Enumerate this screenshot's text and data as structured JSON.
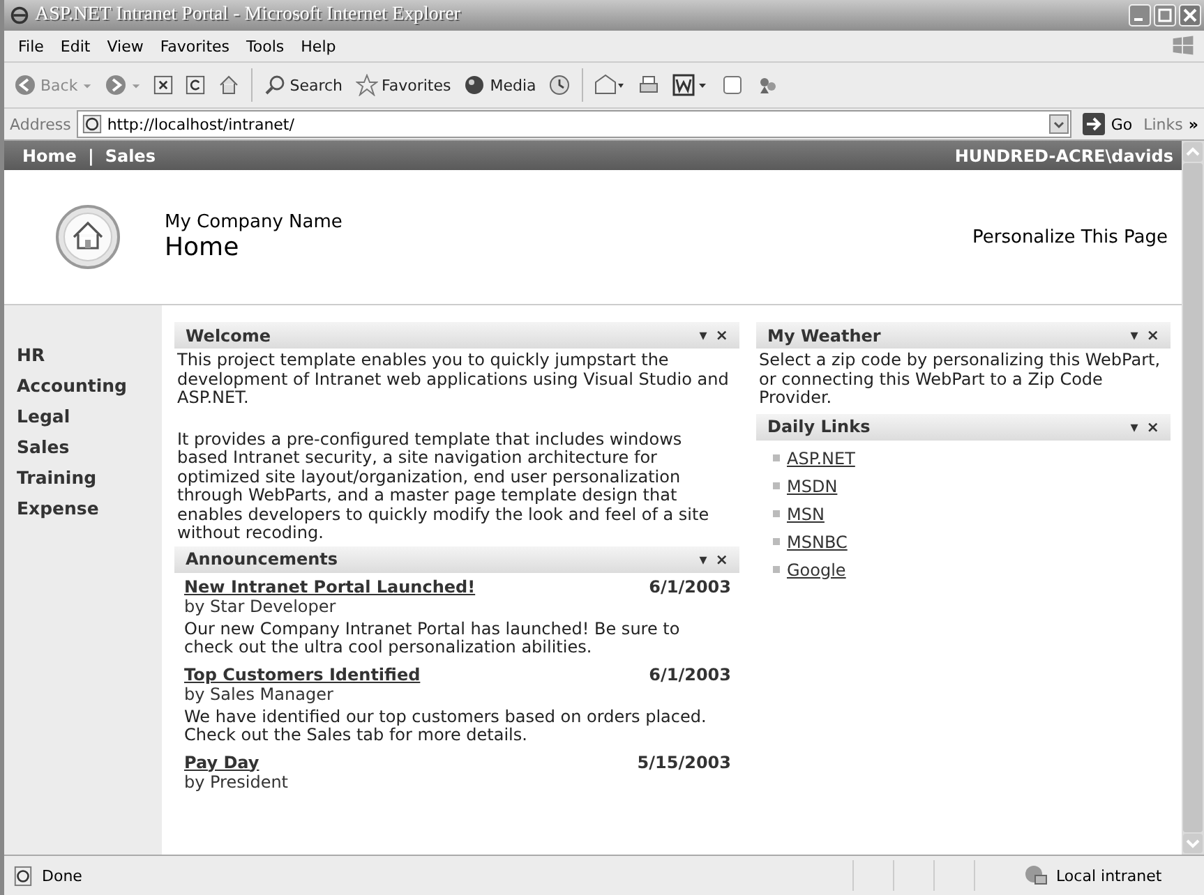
{
  "window": {
    "title": "ASP.NET Intranet Portal - Microsoft Internet Explorer"
  },
  "menu": [
    "File",
    "Edit",
    "View",
    "Favorites",
    "Tools",
    "Help"
  ],
  "toolbar": [
    {
      "kind": "back",
      "label": "Back"
    },
    {
      "kind": "forward"
    },
    {
      "kind": "stop"
    },
    {
      "kind": "refresh"
    },
    {
      "kind": "home"
    },
    {
      "kind": "search",
      "label": "Search"
    },
    {
      "kind": "favorites",
      "label": "Favorites"
    },
    {
      "kind": "media",
      "label": "Media"
    },
    {
      "kind": "history"
    },
    {
      "kind": "mail"
    },
    {
      "kind": "print"
    },
    {
      "kind": "word"
    },
    {
      "kind": "discuss"
    },
    {
      "kind": "messenger"
    }
  ],
  "address": {
    "label": "Address",
    "url": "http://localhost/intranet/",
    "go": "Go",
    "links": "Links",
    "more": "»"
  },
  "topnav": {
    "items": [
      "Home",
      "Sales"
    ],
    "separator": "|",
    "user": "HUNDRED-ACRE\\davids"
  },
  "header": {
    "company": "My Company Name",
    "title": "Home",
    "personalize": "Personalize This Page"
  },
  "sidebar": [
    "HR",
    "Accounting",
    "Legal",
    "Sales",
    "Training",
    "Expense"
  ],
  "welcome": {
    "title": "Welcome",
    "menu_glyph": "▾",
    "close_glyph": "×",
    "paragraphs": [
      "This project template enables you to quickly jumpstart the development of Intranet web applications using Visual Studio and ASP.NET.",
      "It provides a pre-configured template that includes windows based Intranet security, a site navigation architecture for optimized site layout/organization, end user personalization through WebParts, and a master page template design that enables developers to quickly modify the look and feel of a site without recoding."
    ]
  },
  "announcements": {
    "title": "Announcements",
    "menu_glyph": "▾",
    "close_glyph": "×",
    "items": [
      {
        "title": "New Intranet Portal Launched!",
        "date": "6/1/2003",
        "author": "by Star Developer",
        "body": "Our new Company Intranet Portal has launched! Be sure to check out the ultra cool personalization abilities."
      },
      {
        "title": "Top Customers Identified",
        "date": "6/1/2003",
        "author": "by Sales Manager",
        "body": "We have identified our top customers based on orders placed. Check out the Sales tab for more details."
      },
      {
        "title": "Pay Day",
        "date": "5/15/2003",
        "author": "by President"
      }
    ]
  },
  "weather": {
    "title": "My Weather",
    "menu_glyph": "▾",
    "close_glyph": "×",
    "text": "Select a zip code by personalizing this WebPart, or connecting this WebPart to a Zip Code Provider."
  },
  "daily_links": {
    "title": "Daily Links",
    "menu_glyph": "▾",
    "close_glyph": "×",
    "links": [
      "ASP.NET",
      "MSDN",
      "MSN",
      "MSNBC",
      "Google"
    ]
  },
  "status_bar": {
    "text": "Done",
    "zone": "Local intranet"
  }
}
